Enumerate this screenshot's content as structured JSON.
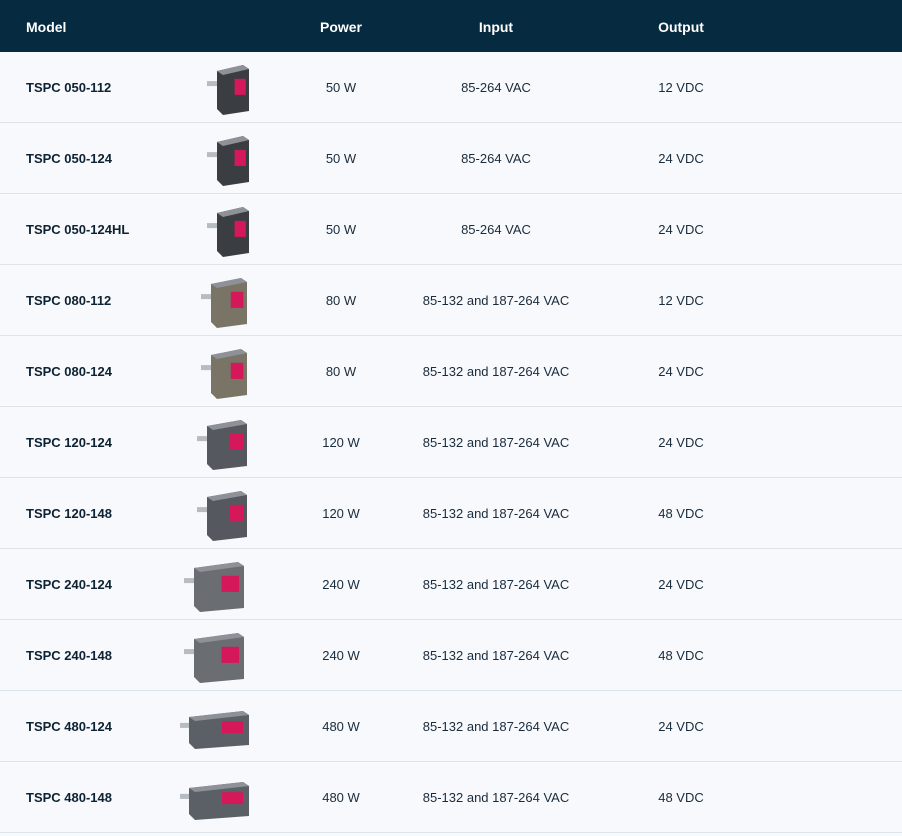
{
  "header": {
    "model": "Model",
    "power": "Power",
    "input": "Input",
    "output": "Output"
  },
  "colors": {
    "header_bg": "#062a3f",
    "accent_red": "#d4185a",
    "row_bg": "#f7f9fc"
  },
  "rows": [
    {
      "model": "TSPC 050-112",
      "power": "50 W",
      "input": "85-264 VAC",
      "output": "12 VDC",
      "image": "power-supply-50w-icon"
    },
    {
      "model": "TSPC 050-124",
      "power": "50 W",
      "input": "85-264 VAC",
      "output": "24 VDC",
      "image": "power-supply-50w-icon"
    },
    {
      "model": "TSPC 050-124HL",
      "power": "50 W",
      "input": "85-264 VAC",
      "output": "24 VDC",
      "image": "power-supply-50w-icon"
    },
    {
      "model": "TSPC 080-112",
      "power": "80 W",
      "input": "85-132 and 187-264 VAC",
      "output": "12 VDC",
      "image": "power-supply-80w-icon"
    },
    {
      "model": "TSPC 080-124",
      "power": "80 W",
      "input": "85-132 and 187-264 VAC",
      "output": "24 VDC",
      "image": "power-supply-80w-icon"
    },
    {
      "model": "TSPC 120-124",
      "power": "120 W",
      "input": "85-132 and 187-264 VAC",
      "output": "24 VDC",
      "image": "power-supply-120w-icon"
    },
    {
      "model": "TSPC 120-148",
      "power": "120 W",
      "input": "85-132 and 187-264 VAC",
      "output": "48 VDC",
      "image": "power-supply-120w-icon"
    },
    {
      "model": "TSPC 240-124",
      "power": "240 W",
      "input": "85-132 and 187-264 VAC",
      "output": "24 VDC",
      "image": "power-supply-240w-icon"
    },
    {
      "model": "TSPC 240-148",
      "power": "240 W",
      "input": "85-132 and 187-264 VAC",
      "output": "48 VDC",
      "image": "power-supply-240w-icon"
    },
    {
      "model": "TSPC 480-124",
      "power": "480 W",
      "input": "85-132 and 187-264 VAC",
      "output": "24 VDC",
      "image": "power-supply-480w-icon"
    },
    {
      "model": "TSPC 480-148",
      "power": "480 W",
      "input": "85-132 and 187-264 VAC",
      "output": "48 VDC",
      "image": "power-supply-480w-icon"
    }
  ]
}
